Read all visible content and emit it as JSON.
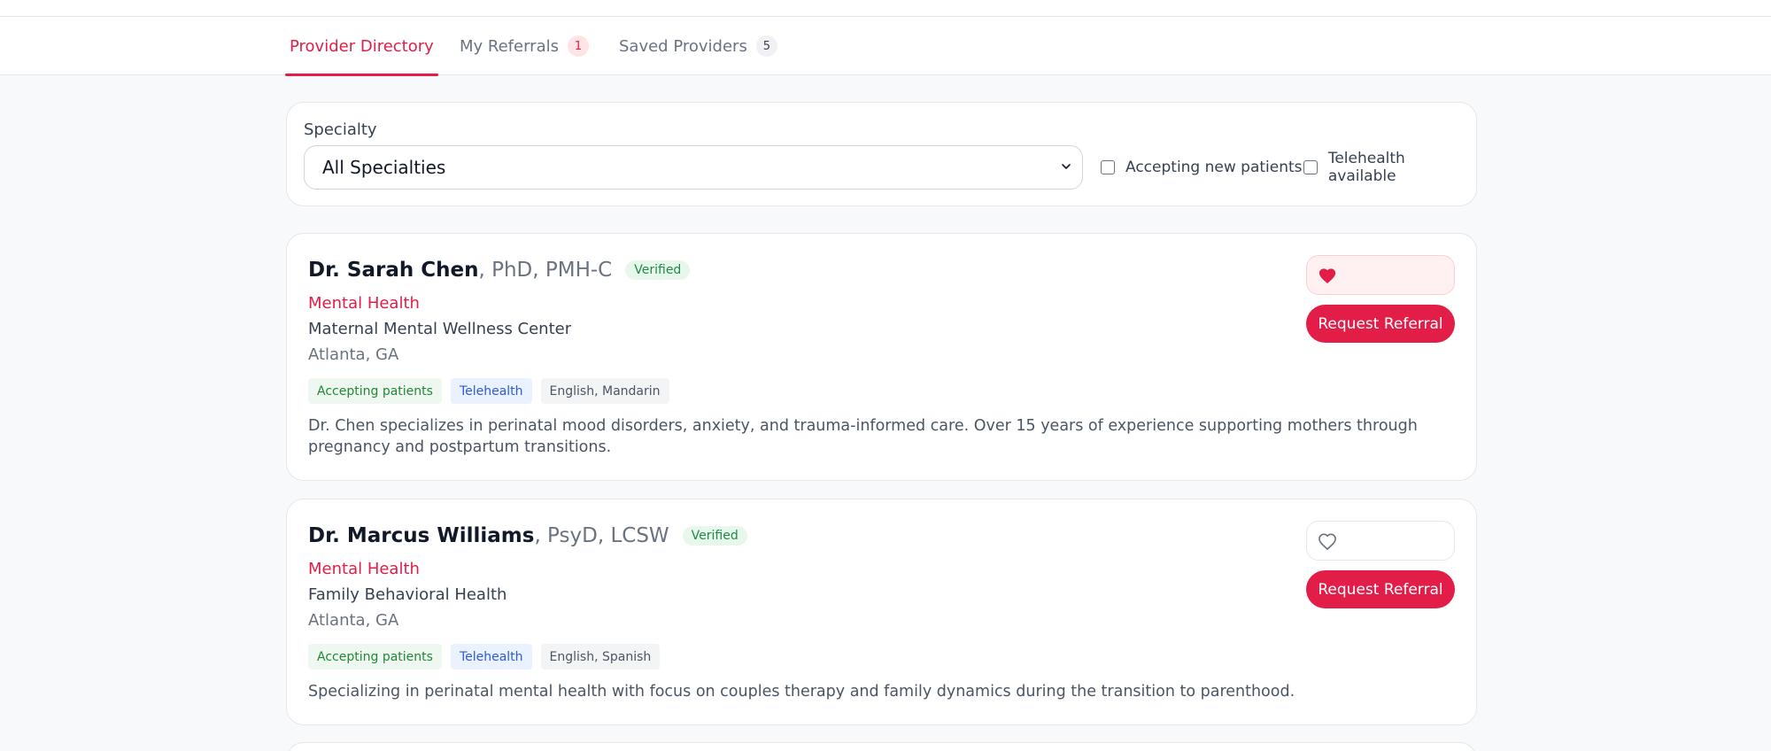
{
  "tabs": [
    {
      "label": "Provider Directory",
      "badge": ""
    },
    {
      "label": "My Referrals",
      "badge": "1"
    },
    {
      "label": "Saved Providers",
      "badge": "5"
    }
  ],
  "filters": {
    "specialty_label": "Specialty",
    "specialty_value": "All Specialties",
    "accepting_label": "Accepting new patients",
    "telehealth_label": "Telehealth available"
  },
  "providers": [
    {
      "name": "Dr. Sarah Chen",
      "credentials": ", PhD, PMH-C",
      "verified": "Verified",
      "specialty": "Mental Health",
      "organization": "Maternal Mental Wellness Center",
      "location": "Atlanta, GA",
      "tags": [
        "Accepting patients",
        "Telehealth",
        "English, Mandarin"
      ],
      "description": "Dr. Chen specializes in perinatal mood disorders, anxiety, and trauma-informed care. Over 15 years of experience supporting mothers through pregnancy and postpartum transitions.",
      "saved": true,
      "referral_label": "Request Referral"
    },
    {
      "name": "Dr. Marcus Williams",
      "credentials": ", PsyD, LCSW",
      "verified": "Verified",
      "specialty": "Mental Health",
      "organization": "Family Behavioral Health",
      "location": "Atlanta, GA",
      "tags": [
        "Accepting patients",
        "Telehealth",
        "English, Spanish"
      ],
      "description": "Specializing in perinatal mental health with focus on couples therapy and family dynamics during the transition to parenthood.",
      "saved": false,
      "referral_label": "Request Referral"
    }
  ],
  "colors": {
    "accent": "#e11d48",
    "verified": "#1f8a46",
    "telehealth": "#2f5bd3"
  },
  "icons": {
    "saved": "heart-filled-icon",
    "unsaved": "heart-outline-icon",
    "select": "chevron-down-icon"
  }
}
